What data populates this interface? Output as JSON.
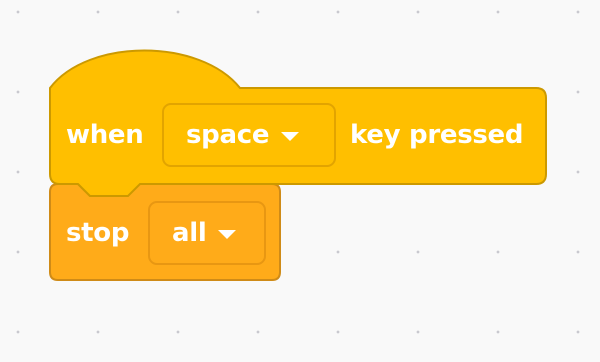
{
  "workspace": {
    "background_color": "#f9f9f9",
    "grid_dot_color": "#c9c9cf"
  },
  "when_key_block": {
    "category": "events",
    "color": "#ffbf00",
    "border_color": "#cc9900",
    "prefix_label": "when",
    "key_value": "space",
    "suffix_label": "key pressed"
  },
  "stop_block": {
    "category": "control",
    "color": "#ffab19",
    "border_color": "#cf8b17",
    "label": "stop",
    "option_value": "all"
  },
  "icons": {
    "dropdown_caret": "chevron-down-icon"
  }
}
